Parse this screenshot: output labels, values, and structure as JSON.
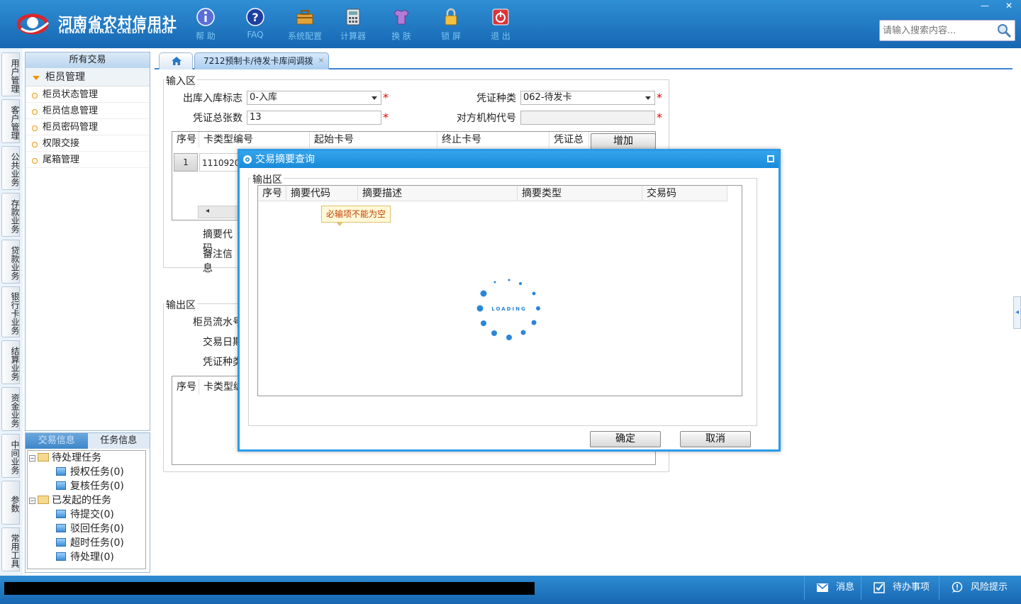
{
  "app": {
    "logo_cn": "河南省农村信用社",
    "logo_en": "HENAN RURAL CREDIT UNION",
    "search_placeholder": "请输入搜索内容...",
    "window_controls": {
      "minimize": "—",
      "close": "✕"
    }
  },
  "toolbar": [
    {
      "label": "帮 助",
      "icon": "info-icon"
    },
    {
      "label": "FAQ",
      "icon": "question-icon"
    },
    {
      "label": "系统配置",
      "icon": "toolbox-icon"
    },
    {
      "label": "计算器",
      "icon": "calculator-icon"
    },
    {
      "label": "换 肤",
      "icon": "shirt-icon"
    },
    {
      "label": "锁 屏",
      "icon": "lock-icon"
    },
    {
      "label": "退 出",
      "icon": "power-icon"
    }
  ],
  "left_tabs": [
    "用户管理",
    "客户管理",
    "公共业务",
    "存款业务",
    "贷款业务",
    "银行卡业务",
    "结算业务",
    "资金业务",
    "中间业务",
    "参数",
    "常用工具"
  ],
  "menu": {
    "header": "所有交易",
    "group": "柜员管理",
    "items": [
      "柜员状态管理",
      "柜员信息管理",
      "柜员密码管理",
      "权限交接",
      "尾箱管理"
    ]
  },
  "tasks": {
    "tabs": [
      "交易信息",
      "任务信息"
    ],
    "tree": [
      {
        "label": "待处理任务",
        "level": 0
      },
      {
        "label": "授权任务(0)",
        "level": 1
      },
      {
        "label": "复核任务(0)",
        "level": 1
      },
      {
        "label": "已发起的任务",
        "level": 0
      },
      {
        "label": "待提交(0)",
        "level": 1
      },
      {
        "label": "驳回任务(0)",
        "level": 1
      },
      {
        "label": "超时任务(0)",
        "level": 1
      },
      {
        "label": "待处理(0)",
        "level": 1
      }
    ]
  },
  "tabs": {
    "active": "7212预制卡/待发卡库间调拨",
    "close": "×"
  },
  "form": {
    "input_legend": "输入区",
    "stock_flag_label": "出库入库标志",
    "stock_flag_value": "0-入库",
    "voucher_type_label": "凭证种类",
    "voucher_type_value": "062-待发卡",
    "voucher_total_label": "凭证总张数",
    "voucher_total_value": "13",
    "counterpart_label": "对方机构代号",
    "counterpart_value": "",
    "grid_headers": [
      "序号",
      "卡类型编号",
      "起始卡号",
      "终止卡号",
      "凭证总"
    ],
    "grid_row": {
      "no": "1",
      "card_type": "1110920"
    },
    "add_button": "增加",
    "summary_code_label": "摘要代码",
    "remark_label": "备注信息",
    "output_legend": "输出区",
    "teller_serial_label": "柜员流水号",
    "trade_date_label": "交易日期",
    "voucher_kind_label": "凭证种类",
    "output_grid_headers": [
      "序号",
      "卡类型编"
    ]
  },
  "dialog": {
    "title": "交易摘要查询",
    "output_legend": "输出区",
    "headers": [
      "序号",
      "摘要代码",
      "摘要描述",
      "摘要类型",
      "交易码"
    ],
    "tooltip": "必输项不能为空",
    "loading_text": "LOADING",
    "ok_button": "确定",
    "cancel_button": "取消"
  },
  "statusbar": {
    "items": [
      {
        "label": "消息",
        "icon": "mail-icon"
      },
      {
        "label": "待办事项",
        "icon": "checkbox-icon"
      },
      {
        "label": "风险提示",
        "icon": "chat-icon"
      }
    ]
  }
}
